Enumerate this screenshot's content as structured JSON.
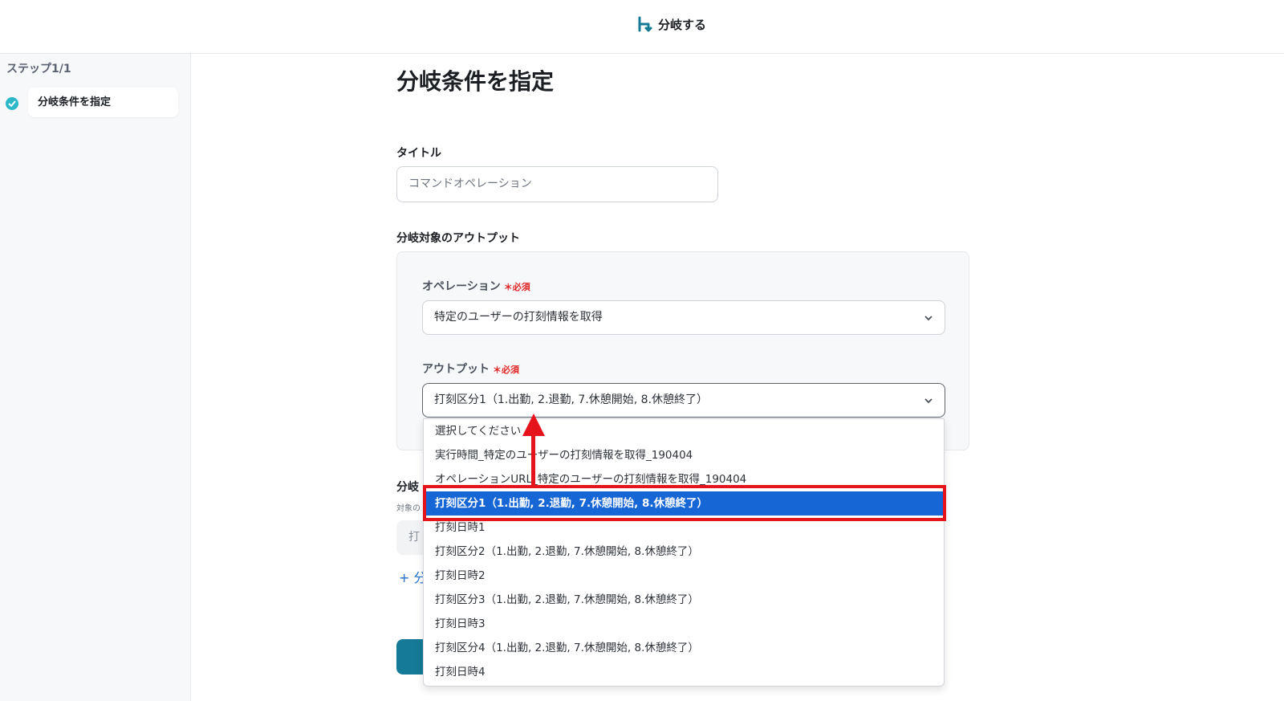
{
  "header": {
    "title": "分岐する"
  },
  "sidebar": {
    "step_label": "ステップ1/1",
    "step_item": "分岐条件を指定"
  },
  "main": {
    "page_title": "分岐条件を指定",
    "title_label": "タイトル",
    "title_value": "コマンドオペレーション",
    "output_section_label": "分岐対象のアウトプット",
    "operation_label": "オペレーション",
    "operation_required": "必須",
    "operation_value": "特定のユーザーの打刻情報を取得",
    "output_label": "アウトプット",
    "output_required": "必須",
    "output_value": "打刻区分1（1.出勤, 2.退勤, 7.休憩開始, 8.休憩終了）",
    "hidden_label": "分岐",
    "hidden_sub": "対象の",
    "hidden_input": "打",
    "add_link": "+ 分"
  },
  "dropdown": {
    "options": [
      "選択してください",
      "実行時間_特定のユーザーの打刻情報を取得_190404",
      "オペレーションURL_特定のユーザーの打刻情報を取得_190404",
      "打刻区分1（1.出勤, 2.退勤, 7.休憩開始, 8.休憩終了）",
      "打刻日時1",
      "打刻区分2（1.出勤, 2.退勤, 7.休憩開始, 8.休憩終了）",
      "打刻日時2",
      "打刻区分3（1.出勤, 2.退勤, 7.休憩開始, 8.休憩終了）",
      "打刻日時3",
      "打刻区分4（1.出勤, 2.退勤, 7.休憩開始, 8.休憩終了）",
      "打刻日時4"
    ],
    "selected_index": 3
  },
  "colors": {
    "accent": "#1766d6",
    "annotation": "#e5141c",
    "brand": "#157a96",
    "check": "#2bb8c9"
  }
}
